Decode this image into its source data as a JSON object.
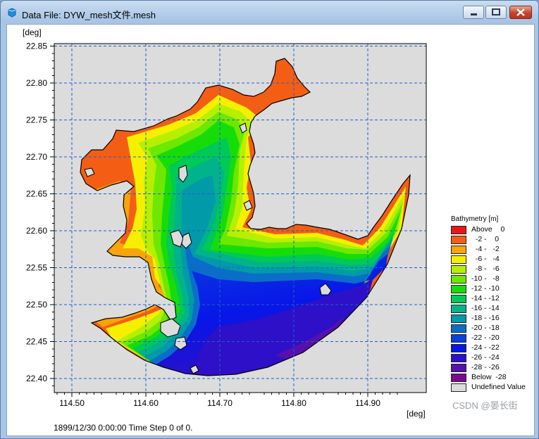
{
  "window": {
    "title": "Data File: DYW_mesh文件.mesh",
    "controls": {
      "minimize": "minimize",
      "maximize": "maximize",
      "close": "close"
    }
  },
  "plot": {
    "y_unit": "[deg]",
    "x_unit": "[deg]",
    "y_ticks": [
      "22.85",
      "22.80",
      "22.75",
      "22.70",
      "22.65",
      "22.60",
      "22.55",
      "22.50",
      "22.45",
      "22.40"
    ],
    "x_ticks": [
      "114.50",
      "114.60",
      "114.70",
      "114.80",
      "114.90"
    ],
    "background_color": "#dcdcdc",
    "grid_color": "#1f5fc8"
  },
  "legend": {
    "title": "Bathymetry [m]",
    "entries": [
      {
        "label": "Above    0",
        "color": "#e8161b"
      },
      {
        "label": "  -2 -    0",
        "color": "#f45e14"
      },
      {
        "label": "  -4 -   -2",
        "color": "#f9a40b"
      },
      {
        "label": "  -6 -   -4",
        "color": "#f6f000"
      },
      {
        "label": "  -8 -   -6",
        "color": "#b6f000"
      },
      {
        "label": "-10 -   -8",
        "color": "#6ee800"
      },
      {
        "label": "-12 - -10",
        "color": "#16dd09"
      },
      {
        "label": "-14 - -12",
        "color": "#00c955"
      },
      {
        "label": "-16 - -14",
        "color": "#00b38a"
      },
      {
        "label": "-18 - -16",
        "color": "#009aa8"
      },
      {
        "label": "-20 - -18",
        "color": "#0a6ec8"
      },
      {
        "label": "-22 - -20",
        "color": "#0b3fe0"
      },
      {
        "label": "-24 - -22",
        "color": "#0716e8"
      },
      {
        "label": "-26 - -24",
        "color": "#2d10c8"
      },
      {
        "label": "-28 - -26",
        "color": "#5610ad"
      },
      {
        "label": "Below  -28",
        "color": "#7b0a8f"
      },
      {
        "label": "Undefined Value",
        "color": "#dcdcdc"
      }
    ]
  },
  "status": "1899/12/30 0:00:00  Time Step 0 of 0.",
  "watermark": "CSDN @晏长街"
}
